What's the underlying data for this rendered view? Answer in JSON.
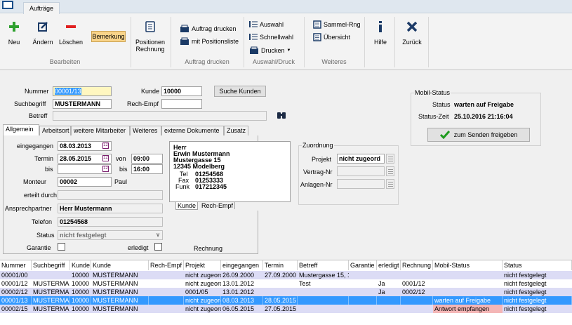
{
  "ribbon": {
    "tab": "Aufträge",
    "buttons": {
      "neu": "Neu",
      "aendern": "Ändern",
      "loeschen": "Löschen",
      "bemerkung": "Bemerkung",
      "positionen": "Positionen",
      "rechnung": "Rechnung",
      "auftrag_drucken": "Auftrag drucken",
      "mit_positionsliste": "mit Positionsliste",
      "auswahl": "Auswahl",
      "schnellwahl": "Schnellwahl",
      "drucken": "Drucken",
      "sammel_rng": "Sammel-Rng",
      "uebersicht": "Übersicht",
      "hilfe": "Hilfe",
      "zurueck": "Zurück"
    },
    "groups": {
      "bearbeiten": "Bearbeiten",
      "auftrag_drucken": "Auftrag drucken",
      "auswahl_druck": "Auswahl/Druck",
      "weiteres": "Weiteres"
    }
  },
  "form": {
    "nummer_label": "Nummer",
    "nummer_value": "00001/13",
    "kunde_label": "Kunde",
    "kunde_value": "10000",
    "suche_kunden": "Suche Kunden",
    "suchbegriff_label": "Suchbegriff",
    "suchbegriff_value": "MUSTERMANN",
    "rech_empf_label": "Rech-Empf",
    "rech_empf_value": "",
    "betreff_label": "Betreff",
    "betreff_value": ""
  },
  "tabs": [
    "Allgemein",
    "Arbeitsort",
    "weitere Mitarbeiter",
    "Weiteres",
    "externe Dokumente",
    "Zusatz"
  ],
  "allgemein": {
    "eingegangen_label": "eingegangen",
    "eingegangen_value": "08.03.2013",
    "termin_label": "Termin",
    "termin_value": "28.05.2015",
    "von_label": "von",
    "von_value": "09:00",
    "bis_label": "bis",
    "bis_date_value": "",
    "bis_time_label": "bis",
    "bis_time_value": "16:00",
    "monteur_label": "Monteur",
    "monteur_value": "00002",
    "monteur_name": "Paul",
    "erteilt_label": "erteilt durch",
    "erteilt_value": "",
    "ansprech_label": "Ansprechpartner",
    "ansprech_value": "Herr Mustermann",
    "telefon_label": "Telefon",
    "telefon_value": "01254568",
    "status_label": "Status",
    "status_value": "nicht festgelegt",
    "garantie_label": "Garantie",
    "erledigt_label": "erledigt",
    "rechnung_label": "Rechnung"
  },
  "address": {
    "anrede": "Herr",
    "name": "Erwin Mustermann",
    "strasse": "Mustergasse 15",
    "ort": "12345  Modelberg",
    "tel_label": "Tel",
    "tel": "01254568",
    "fax_label": "Fax",
    "fax": "01253333",
    "funk_label": "Funk",
    "funk": "017212345",
    "tab_kunde": "Kunde",
    "tab_rech": "Rech-Empf"
  },
  "zuordnung": {
    "title": "Zuordnung",
    "projekt_label": "Projekt",
    "projekt_value": "nicht zugeord",
    "vertrag_label": "Vertrag-Nr",
    "vertrag_value": "",
    "anlagen_label": "Anlagen-Nr",
    "anlagen_value": ""
  },
  "mobil": {
    "title": "Mobil-Status",
    "status_label": "Status",
    "status_value": "warten auf Freigabe",
    "zeit_label": "Status-Zeit",
    "zeit_value": "25.10.2016 21:16:04",
    "freigeben": "zum Senden freigeben"
  },
  "table": {
    "columns": [
      "Nummer",
      "Suchbegriff",
      "Kunde",
      "Kunde",
      "Rech-Empf",
      "Projekt",
      "eingegangen",
      "Termin",
      "Betreff",
      "Garantie",
      "erledigt",
      "Rechnung",
      "Mobil-Status",
      "Status"
    ],
    "rows": [
      [
        "00001/00",
        "",
        "10000",
        "MUSTERMANN",
        "",
        "nicht zugeord",
        "26.09.2000",
        "27.09.2000",
        "Mustergasse 15, 1",
        "",
        "",
        "",
        "",
        "nicht festgelegt"
      ],
      [
        "00001/12",
        "MUSTERMA",
        "10000",
        "MUSTERMANN",
        "",
        "nicht zugeord",
        "13.01.2012",
        "",
        "Test",
        "",
        "Ja",
        "0001/12",
        "",
        "nicht festgelegt"
      ],
      [
        "00002/12",
        "MUSTERMA",
        "10000",
        "MUSTERMANN",
        "",
        "0001/05",
        "13.01.2012",
        "",
        "",
        "",
        "Ja",
        "0002/12",
        "",
        "nicht festgelegt"
      ],
      [
        "00001/13",
        "MUSTERMA",
        "10000",
        "MUSTERMANN",
        "",
        "nicht zugeord",
        "08.03.2013",
        "28.05.2015",
        "",
        "",
        "",
        "",
        "warten auf Freigabe",
        "nicht festgelegt"
      ],
      [
        "00002/15",
        "MUSTERMA",
        "10000",
        "MUSTERMANN",
        "",
        "nicht zugeord",
        "06.05.2015",
        "27.05.2015",
        "",
        "",
        "",
        "",
        "Antwort empfangen",
        "nicht festgelegt"
      ]
    ]
  },
  "colors": {
    "selected_row": "#3399ff",
    "alt_row": "#dcdcf5",
    "antwort": "#f4b6b6",
    "accent_blue": "#1b4e8a"
  }
}
